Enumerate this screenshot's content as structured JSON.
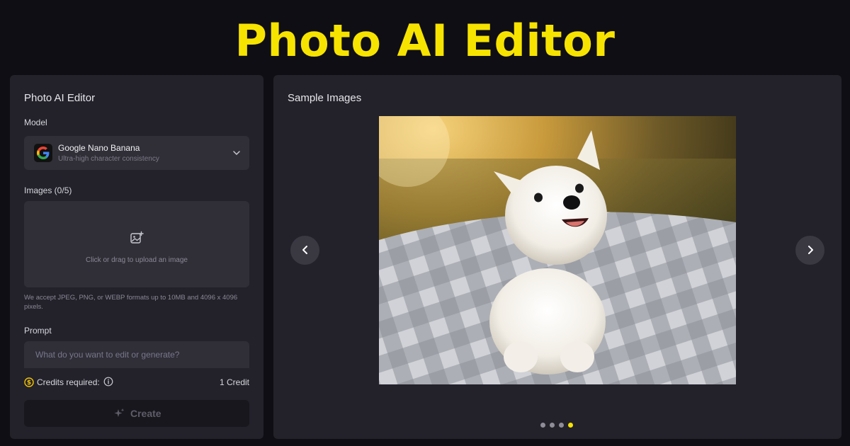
{
  "hero": {
    "title": "Photo AI Editor"
  },
  "editor": {
    "title": "Photo AI Editor",
    "model_label": "Model",
    "model": {
      "name": "Google Nano Banana",
      "description": "Ultra-high character consistency"
    },
    "images_label": "Images (0/5)",
    "upload_text": "Click or drag to upload an image",
    "accept_text": "We accept JPEG, PNG, or WEBP formats up to 10MB and 4096 x 4096 pixels.",
    "prompt_label": "Prompt",
    "prompt_placeholder": "What do you want to edit or generate?",
    "credits_label": "Credits required:",
    "credits_value": "1 Credit",
    "create_label": "Create"
  },
  "samples": {
    "title": "Sample Images",
    "current_index": 3,
    "total": 4
  },
  "colors": {
    "hero_title": "#f7e300",
    "active_dot": "#f7e300",
    "inactive_dot": "#8f8e98",
    "panel_bg": "#23222b"
  }
}
